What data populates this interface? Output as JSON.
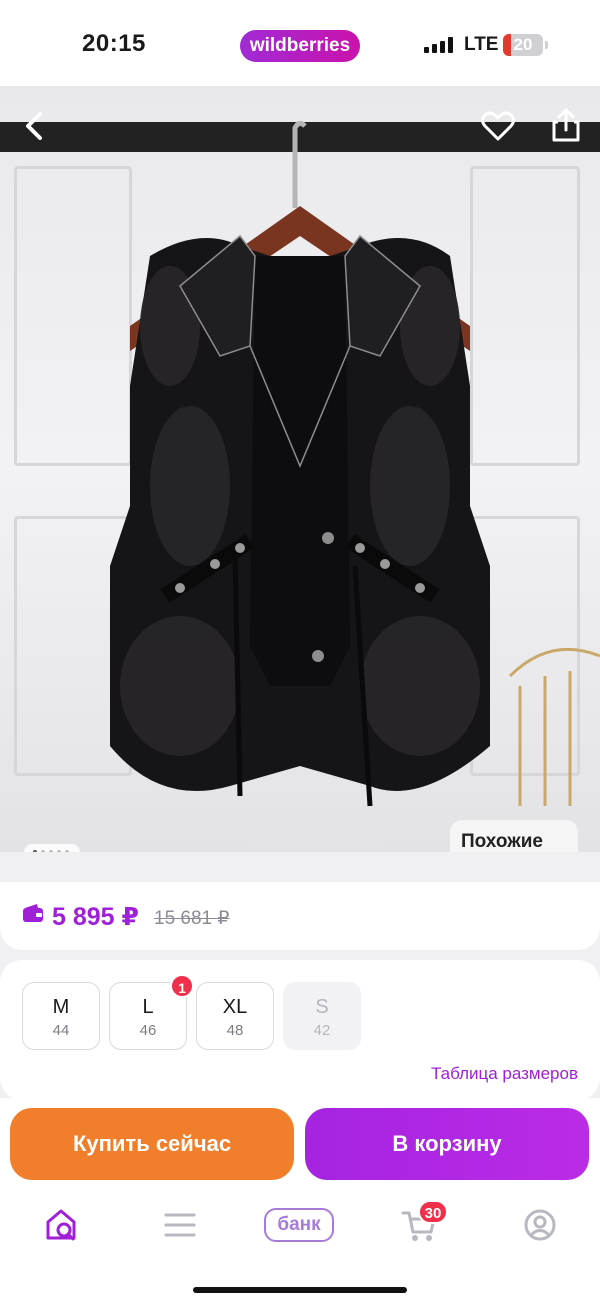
{
  "status_bar": {
    "time": "20:15",
    "brand": "wildberries",
    "network": "LTE",
    "battery_level": "20",
    "battery_fraction": 0.2,
    "battery_color": "#e23b2e"
  },
  "product": {
    "image_alt": "Меховой жилет",
    "similar_label": "Похожие",
    "gallery_dots": 5,
    "active_dot": 1
  },
  "price": {
    "current": "5 895 ₽",
    "old": "15 681 ₽",
    "accent_color": "#a020d8"
  },
  "sizes": {
    "options": [
      {
        "name": "M",
        "ru": "44",
        "available": true,
        "badge": ""
      },
      {
        "name": "L",
        "ru": "46",
        "available": true,
        "badge": "1"
      },
      {
        "name": "XL",
        "ru": "48",
        "available": true,
        "badge": ""
      },
      {
        "name": "S",
        "ru": "42",
        "available": false,
        "badge": ""
      }
    ],
    "table_link": "Таблица размеров"
  },
  "actions": {
    "buy_now": "Купить сейчас",
    "add_to_cart": "В корзину",
    "buy_color": "#f07e2b",
    "cart_color": "#a524e0"
  },
  "tabbar": {
    "items": [
      {
        "icon": "home-search-icon"
      },
      {
        "icon": "menu-icon"
      },
      {
        "icon": "bank-icon",
        "label": "банк"
      },
      {
        "icon": "cart-icon",
        "badge": "30"
      },
      {
        "icon": "profile-icon"
      }
    ]
  }
}
